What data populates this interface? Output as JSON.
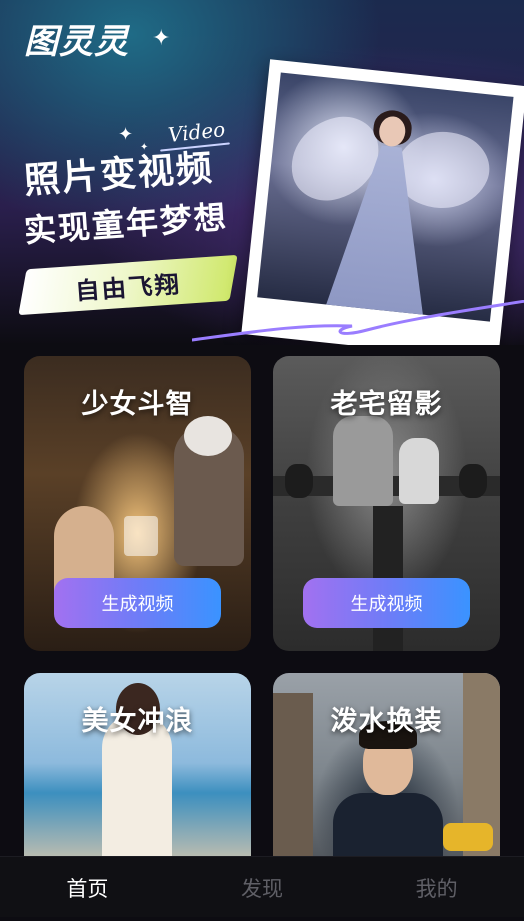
{
  "app": {
    "logo_text": "图灵灵"
  },
  "hero": {
    "video_word": "Video",
    "headline_line1": "照片变视频",
    "headline_line2": "实现童年梦想",
    "tag_text": "自由飞翔"
  },
  "cards": [
    {
      "title": "少女斗智",
      "button": "生成视频"
    },
    {
      "title": "老宅留影",
      "button": "生成视频"
    },
    {
      "title": "美女冲浪"
    },
    {
      "title": "泼水换装"
    }
  ],
  "bottom_nav": {
    "items": [
      {
        "label": "首页",
        "active": true
      },
      {
        "label": "发现",
        "active": false
      },
      {
        "label": "我的",
        "active": false
      }
    ]
  },
  "colors": {
    "button_gradient_start": "#a271f0",
    "button_gradient_end": "#3a93ff",
    "nav_active": "#ffffff",
    "nav_inactive": "#5f5f66"
  }
}
